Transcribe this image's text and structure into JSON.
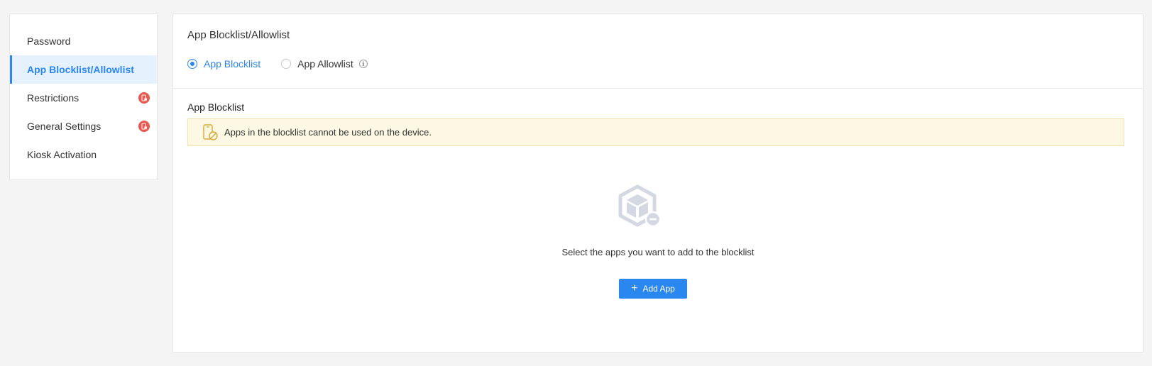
{
  "sidebar": {
    "items": [
      {
        "label": "Password",
        "active": false,
        "badge": false
      },
      {
        "label": "App Blocklist/Allowlist",
        "active": true,
        "badge": false
      },
      {
        "label": "Restrictions",
        "active": false,
        "badge": true
      },
      {
        "label": "General Settings",
        "active": false,
        "badge": true
      },
      {
        "label": "Kiosk Activation",
        "active": false,
        "badge": false
      }
    ],
    "badge_icon": "device-lock-icon",
    "accent_color": "#2b87f0",
    "badge_color": "#e8594f"
  },
  "main": {
    "title": "App Blocklist/Allowlist",
    "mode": {
      "options": [
        {
          "label": "App Blocklist",
          "checked": true
        },
        {
          "label": "App Allowlist",
          "checked": false
        }
      ],
      "info_icon": "i"
    },
    "section_title": "App Blocklist",
    "notice": {
      "text": "Apps in the blocklist cannot be used on the device.",
      "icon": "phone-blocked-icon",
      "bg_color": "#fdf8e3"
    },
    "empty_state": {
      "icon": "package-minus-icon",
      "text": "Select the apps you want to add to the blocklist"
    },
    "add_button": {
      "icon": "+",
      "label": "Add App"
    }
  }
}
